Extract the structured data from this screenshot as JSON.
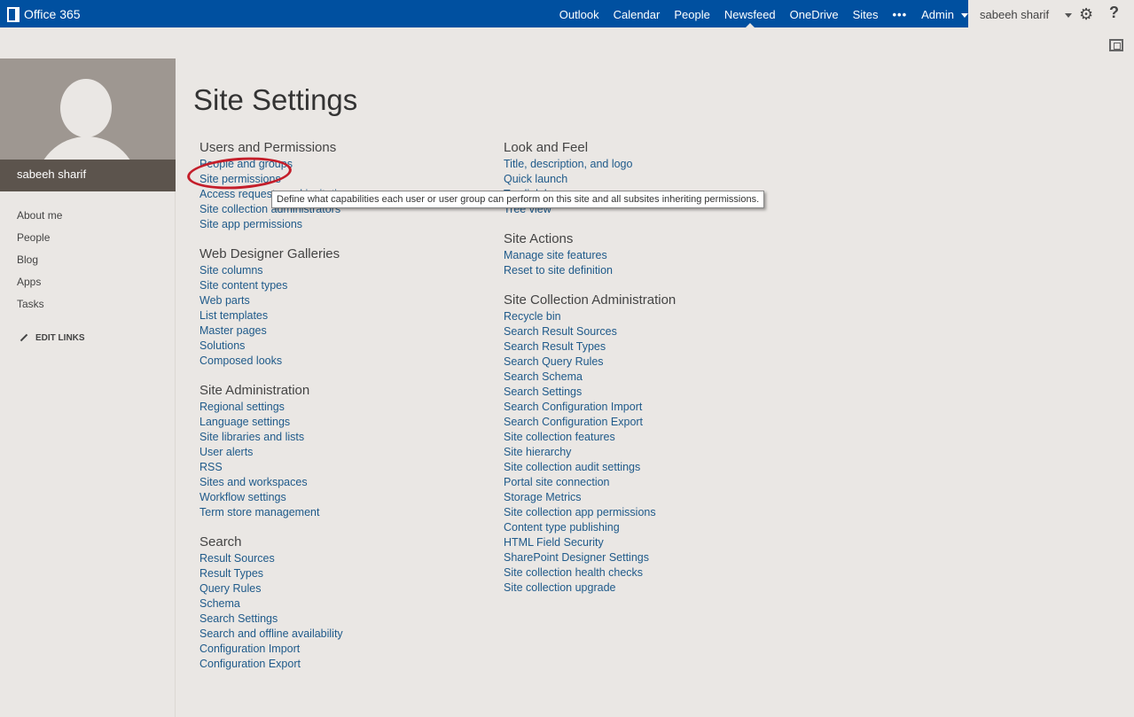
{
  "topbar": {
    "brand": "Office 365",
    "nav": [
      "Outlook",
      "Calendar",
      "People",
      "Newsfeed",
      "OneDrive",
      "Sites"
    ],
    "more": "•••",
    "admin": "Admin",
    "user": "sabeeh sharif",
    "help": "?"
  },
  "sidebar": {
    "profile_name": "sabeeh sharif",
    "links": [
      "About me",
      "People",
      "Blog",
      "Apps",
      "Tasks"
    ],
    "edit_links": "EDIT LINKS"
  },
  "page": {
    "title": "Site Settings"
  },
  "columns": [
    [
      {
        "title": "Users and Permissions",
        "links": [
          "People and groups",
          "Site permissions",
          "Access requests and invitations",
          "Site collection administrators",
          "Site app permissions"
        ]
      },
      {
        "title": "Web Designer Galleries",
        "links": [
          "Site columns",
          "Site content types",
          "Web parts",
          "List templates",
          "Master pages",
          "Solutions",
          "Composed looks"
        ]
      },
      {
        "title": "Site Administration",
        "links": [
          "Regional settings",
          "Language settings",
          "Site libraries and lists",
          "User alerts",
          "RSS",
          "Sites and workspaces",
          "Workflow settings",
          "Term store management"
        ]
      },
      {
        "title": "Search",
        "links": [
          "Result Sources",
          "Result Types",
          "Query Rules",
          "Schema",
          "Search Settings",
          "Search and offline availability",
          "Configuration Import",
          "Configuration Export"
        ]
      }
    ],
    [
      {
        "title": "Look and Feel",
        "links": [
          "Title, description, and logo",
          "Quick launch",
          "Top link bar",
          "Tree view"
        ]
      },
      {
        "title": "Site Actions",
        "links": [
          "Manage site features",
          "Reset to site definition"
        ]
      },
      {
        "title": "Site Collection Administration",
        "links": [
          "Recycle bin",
          "Search Result Sources",
          "Search Result Types",
          "Search Query Rules",
          "Search Schema",
          "Search Settings",
          "Search Configuration Import",
          "Search Configuration Export",
          "Site collection features",
          "Site hierarchy",
          "Site collection audit settings",
          "Portal site connection",
          "Storage Metrics",
          "Site collection app permissions",
          "Content type publishing",
          "HTML Field Security",
          "SharePoint Designer Settings",
          "Site collection health checks",
          "Site collection upgrade"
        ]
      }
    ]
  ],
  "tooltip": "Define what capabilities each user or user group can perform on this site and all subsites inheriting permissions.",
  "colors": {
    "suite_bar": "#0050a0",
    "link": "#1f5a8a",
    "highlight_circle": "#c41e2a"
  }
}
